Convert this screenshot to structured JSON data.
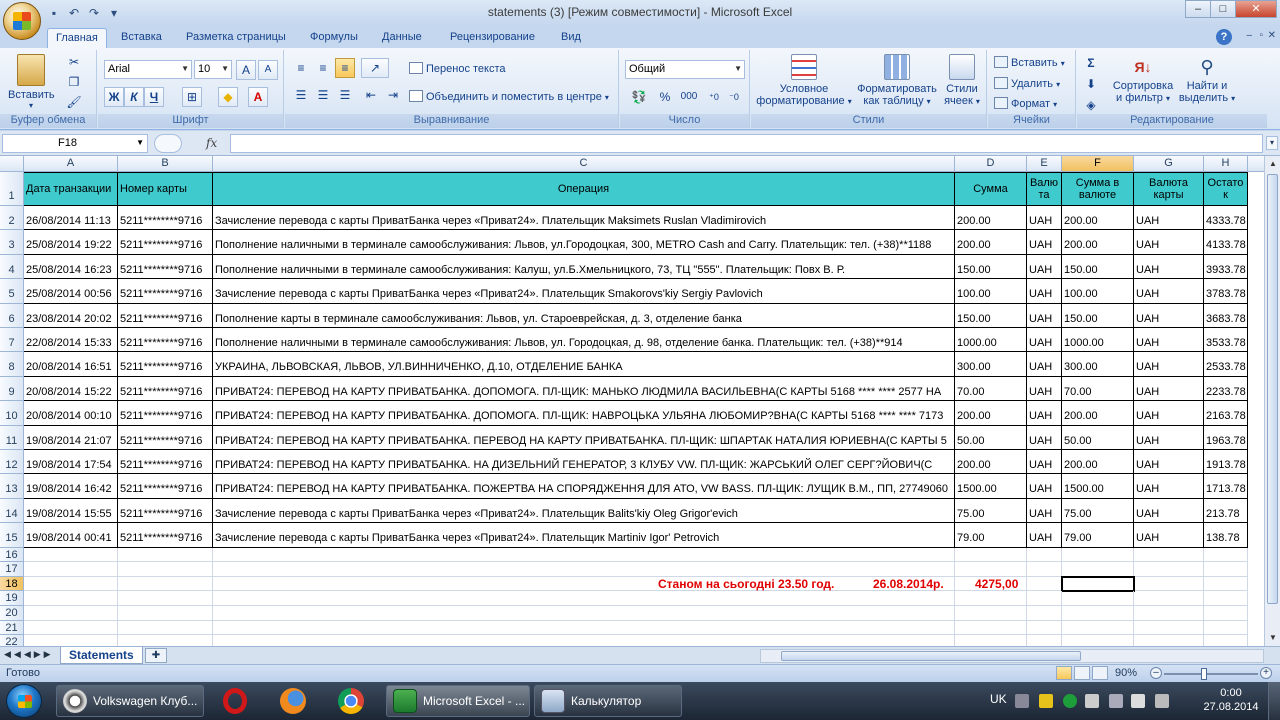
{
  "window": {
    "title": "statements (3)  [Режим совместимости] - Microsoft Excel"
  },
  "ribbon_tabs": [
    {
      "label": "Главная",
      "active": true
    },
    {
      "label": "Вставка"
    },
    {
      "label": "Разметка страницы"
    },
    {
      "label": "Формулы"
    },
    {
      "label": "Данные"
    },
    {
      "label": "Рецензирование"
    },
    {
      "label": "Вид"
    }
  ],
  "ribbon": {
    "clipboard": {
      "paste": "Вставить",
      "label": "Буфер обмена"
    },
    "font": {
      "name": "Arial",
      "size": "10",
      "label": "Шрифт",
      "bold": "Ж",
      "italic": "К",
      "underline": "Ч"
    },
    "alignment": {
      "wrap": "Перенос текста",
      "merge": "Объединить и поместить в центре",
      "label": "Выравнивание"
    },
    "number": {
      "format": "Общий",
      "label": "Число",
      "percent": "%",
      "thousands": "000"
    },
    "styles": {
      "conditional_l1": "Условное",
      "conditional_l2": "форматирование",
      "table_l1": "Форматировать",
      "table_l2": "как таблицу",
      "cell_l1": "Стили",
      "cell_l2": "ячеек",
      "label": "Стили"
    },
    "cells": {
      "insert": "Вставить",
      "delete": "Удалить",
      "format": "Формат",
      "label": "Ячейки"
    },
    "editing": {
      "sort_l1": "Сортировка",
      "sort_l2": "и фильтр",
      "find_l1": "Найти и",
      "find_l2": "выделить",
      "label": "Редактирование"
    }
  },
  "formula_bar": {
    "name_box": "F18",
    "fx": "fx",
    "value": ""
  },
  "columns": [
    "A",
    "B",
    "C",
    "D",
    "E",
    "F",
    "G",
    "H"
  ],
  "header_row": {
    "row_number": "1",
    "cells": [
      "Дата транзакции",
      "Номер карты",
      "Операция",
      "Сумма",
      "Валю та",
      "Сумма в валюте",
      "Валюта карты",
      "Остато к"
    ]
  },
  "rows": [
    {
      "n": "2",
      "cells": [
        "26/08/2014 11:13",
        "5211********9716",
        "Зачисление перевода с карты ПриватБанка через «Приват24». Плательщик Maksimets Ruslan Vladimirovich",
        "200.00",
        "UAH",
        "200.00",
        "UAH",
        "4333.78"
      ]
    },
    {
      "n": "3",
      "cells": [
        "25/08/2014 19:22",
        "5211********9716",
        "Пополнение наличными в терминале самообслуживания: Львов, ул.Городоцкая, 300, METRO Cash and Carry. Плательщик: тел. (+38)**1188",
        "200.00",
        "UAH",
        "200.00",
        "UAH",
        "4133.78"
      ]
    },
    {
      "n": "4",
      "cells": [
        "25/08/2014 16:23",
        "5211********9716",
        "Пополнение наличными в терминале самообслуживания: Калуш, ул.Б.Хмельницкого, 73, ТЦ \"555\". Плательщик: Повх В. Р.",
        "150.00",
        "UAH",
        "150.00",
        "UAH",
        "3933.78"
      ]
    },
    {
      "n": "5",
      "cells": [
        "25/08/2014 00:56",
        "5211********9716",
        "Зачисление перевода с карты ПриватБанка через «Приват24». Плательщик Smakorovs'kiy Sergiy Pavlovich",
        "100.00",
        "UAH",
        "100.00",
        "UAH",
        "3783.78"
      ]
    },
    {
      "n": "6",
      "cells": [
        "23/08/2014 20:02",
        "5211********9716",
        "Пополнение карты в терминале самообслуживания: Львов, ул. Староеврейская, д. 3, отделение банка",
        "150.00",
        "UAH",
        "150.00",
        "UAH",
        "3683.78"
      ]
    },
    {
      "n": "7",
      "cells": [
        "22/08/2014 15:33",
        "5211********9716",
        "Пополнение наличными в терминале самообслуживания: Львов, ул. Городоцкая, д. 98, отделение банка. Плательщик: тел. (+38)**914",
        "1000.00",
        "UAH",
        "1000.00",
        "UAH",
        "3533.78"
      ]
    },
    {
      "n": "8",
      "cells": [
        "20/08/2014 16:51",
        "5211********9716",
        "УКРАИНА, ЛЬВОВСКАЯ, ЛЬВОВ, УЛ.ВИННИЧЕНКО, Д.10, ОТДЕЛЕНИЕ БАНКА",
        "300.00",
        "UAH",
        "300.00",
        "UAH",
        "2533.78"
      ]
    },
    {
      "n": "9",
      "cells": [
        "20/08/2014 15:22",
        "5211********9716",
        "ПРИВАТ24: ПЕРЕВОД НА КАРТУ ПРИВАТБАНКА. ДОПОМОГА.  ПЛ-ЩИК: МАНЬКО ЛЮДМИЛА ВАСИЛЬЕВНА(С КАРТЫ 5168 **** **** 2577 НА",
        "70.00",
        "UAH",
        "70.00",
        "UAH",
        "2233.78"
      ]
    },
    {
      "n": "10",
      "cells": [
        "20/08/2014 00:10",
        "5211********9716",
        "ПРИВАТ24: ПЕРЕВОД НА КАРТУ ПРИВАТБАНКА. ДОПОМОГА.  ПЛ-ЩИК: НАВРОЦЬКА УЛЬЯНА ЛЮБОМИР?ВНА(С КАРТЫ 5168 **** **** 7173",
        "200.00",
        "UAH",
        "200.00",
        "UAH",
        "2163.78"
      ]
    },
    {
      "n": "11",
      "cells": [
        "19/08/2014 21:07",
        "5211********9716",
        "ПРИВАТ24: ПЕРЕВОД НА КАРТУ ПРИВАТБАНКА. ПЕРЕВОД НА КАРТУ ПРИВАТБАНКА.  ПЛ-ЩИК: ШПАРТАК НАТАЛИЯ ЮРИЕВНА(С КАРТЫ 5",
        "50.00",
        "UAH",
        "50.00",
        "UAH",
        "1963.78"
      ]
    },
    {
      "n": "12",
      "cells": [
        "19/08/2014 17:54",
        "5211********9716",
        "ПРИВАТ24: ПЕРЕВОД НА КАРТУ ПРИВАТБАНКА. НА ДИЗЕЛЬНИЙ ГЕНЕРАТОР, 3 КЛУБУ VW.  ПЛ-ЩИК: ЖАРСЬКИЙ ОЛЕГ СЕРГ?ЙОВИЧ(С",
        "200.00",
        "UAH",
        "200.00",
        "UAH",
        "1913.78"
      ]
    },
    {
      "n": "13",
      "cells": [
        "19/08/2014 16:42",
        "5211********9716",
        "ПРИВАТ24: ПЕРЕВОД НА КАРТУ ПРИВАТБАНКА. ПОЖЕРТВА НА СПОРЯДЖЕННЯ ДЛЯ АТО, VW BASS.  ПЛ-ЩИК: ЛУЩИК В.М., ПП, 27749060",
        "1500.00",
        "UAH",
        "1500.00",
        "UAH",
        "1713.78"
      ]
    },
    {
      "n": "14",
      "cells": [
        "19/08/2014 15:55",
        "5211********9716",
        "Зачисление перевода с карты ПриватБанка через «Приват24». Плательщик Balits'kiy Oleg Grigor'evich",
        "75.00",
        "UAH",
        "75.00",
        "UAH",
        "213.78"
      ]
    },
    {
      "n": "15",
      "cells": [
        "19/08/2014 00:41",
        "5211********9716",
        "Зачисление перевода с карты ПриватБанка через «Приват24». Плательщик Martiniv Igor' Petrovich",
        "79.00",
        "UAH",
        "79.00",
        "UAH",
        "138.78"
      ]
    }
  ],
  "empty_rows": [
    "16",
    "17",
    "18",
    "19",
    "20",
    "21",
    "22"
  ],
  "summary": {
    "row": "18",
    "text": "Станом на сьогодні 23.50 год.",
    "date": "26.08.2014р.",
    "amount": "4275,00"
  },
  "selected_cell": "F18",
  "sheet_tab": "Statements",
  "status": {
    "ready": "Готово",
    "zoom": "90%",
    "zoom_level": 0.42
  },
  "taskbar": {
    "items": [
      {
        "label": "Volkswagen Клуб..."
      },
      {
        "label": "Microsoft Excel - ...",
        "active": true
      },
      {
        "label": "Калькулятор"
      }
    ],
    "lang": "UK",
    "time": "0:00",
    "date": "27.08.2014"
  },
  "colors": {
    "header_fill": "#3fcacd",
    "summary_text": "#e00000",
    "selected_header": "#f1c15f"
  }
}
